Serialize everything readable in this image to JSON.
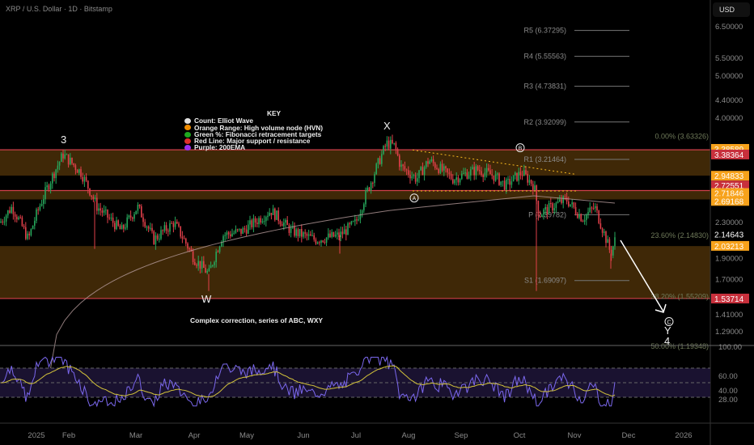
{
  "header": {
    "title": "XRP / U.S. Dollar · 1D · Bitstamp",
    "currency": "USD"
  },
  "key": {
    "title": "KEY",
    "items": [
      {
        "label": "Count: Elliot Wave",
        "color": "#e0e0e0"
      },
      {
        "label": "Orange Range: High volume node (HVN)",
        "color": "#f08c00"
      },
      {
        "label": "Green %: Fibonacci retracement targets",
        "color": "#1fa81f"
      },
      {
        "label": "Red Line: Major support / resistance",
        "color": "#e0302a"
      },
      {
        "label": "Purple: 200EMA",
        "color": "#9b30f0"
      }
    ]
  },
  "annotation": "Complex correction, series of ABC, WXY",
  "wave_labels": {
    "three": "3",
    "w": "W",
    "x": "X",
    "a": "A",
    "b": "B",
    "c": "C",
    "y": "Y",
    "four": "4"
  },
  "pivots": [
    {
      "label": "R5 (6.37295)",
      "price": 6.37295
    },
    {
      "label": "R4 (5.55563)",
      "price": 5.55563
    },
    {
      "label": "R3 (4.73831)",
      "price": 4.73831
    },
    {
      "label": "R2 (3.92099)",
      "price": 3.92099
    },
    {
      "label": "R1 (3.21464)",
      "price": 3.21464
    },
    {
      "label": "P (2.39782)",
      "price": 2.39782
    },
    {
      "label": "S1 (1.69097)",
      "price": 1.69097
    }
  ],
  "fibs": [
    {
      "label": "0.00% (3.63326)",
      "price": 3.63326
    },
    {
      "label": "23.60% (2.14830)",
      "price": 2.1483
    },
    {
      "label": "38.20% (1.55209)",
      "price": 1.55209
    },
    {
      "label": "50.00% (1.19348)",
      "price": 1.19348
    }
  ],
  "price_axis": {
    "ticks": [
      "6.50000",
      "5.50000",
      "5.00000",
      "4.40000",
      "4.00000",
      "2.30000",
      "1.90000",
      "1.70000",
      "1.41000",
      "1.29000"
    ],
    "badges": [
      {
        "text": "3.38589",
        "color": "#f7a21b",
        "price": 3.4
      },
      {
        "text": "3.38364",
        "color": "#c8303c",
        "price": 3.3
      },
      {
        "text": "2.94833",
        "color": "#f7a21b",
        "price": 2.9483
      },
      {
        "text": "2.72551",
        "color": "#c8303c",
        "price": 2.8
      },
      {
        "text": "2.71846",
        "color": "#f7a21b",
        "price": 2.69
      },
      {
        "text": "2.69168",
        "color": "#f7a21b",
        "price": 2.58
      },
      {
        "text": "2.14643",
        "color": "#000000",
        "price": 2.16
      },
      {
        "text": "2.03213",
        "color": "#f7a21b",
        "price": 2.03213
      },
      {
        "text": "1.53714",
        "color": "#c8303c",
        "price": 1.53714
      }
    ]
  },
  "rsi_axis": [
    "100.00",
    "60.00",
    "40.00",
    "28.00"
  ],
  "time_axis": [
    "2025",
    "Feb",
    "Mar",
    "Apr",
    "May",
    "Jun",
    "Jul",
    "Aug",
    "Sep",
    "Oct",
    "Nov",
    "Dec",
    "2026"
  ],
  "chart_data": {
    "type": "candlestick",
    "title": "XRP / U.S. Dollar · 1D · Bitstamp",
    "path": [
      [
        0,
        2.3
      ],
      [
        15,
        2.5
      ],
      [
        35,
        2.1
      ],
      [
        45,
        2.4
      ],
      [
        78,
        3.3
      ],
      [
        100,
        3.0
      ],
      [
        120,
        2.5
      ],
      [
        150,
        2.2
      ],
      [
        170,
        2.5
      ],
      [
        190,
        2.1
      ],
      [
        215,
        2.3
      ],
      [
        240,
        1.9
      ],
      [
        258,
        1.75
      ],
      [
        275,
        2.15
      ],
      [
        300,
        2.2
      ],
      [
        335,
        2.45
      ],
      [
        360,
        2.2
      ],
      [
        390,
        2.1
      ],
      [
        420,
        2.15
      ],
      [
        440,
        2.3
      ],
      [
        460,
        2.9
      ],
      [
        478,
        3.5
      ],
      [
        488,
        3.45
      ],
      [
        495,
        3.1
      ],
      [
        515,
        2.9
      ],
      [
        530,
        3.2
      ],
      [
        560,
        2.9
      ],
      [
        590,
        3.05
      ],
      [
        610,
        2.95
      ],
      [
        625,
        2.8
      ],
      [
        645,
        3.0
      ],
      [
        660,
        2.8
      ],
      [
        666,
        2.4
      ],
      [
        690,
        2.55
      ],
      [
        700,
        2.6
      ],
      [
        720,
        2.35
      ],
      [
        735,
        2.5
      ],
      [
        742,
        2.3
      ],
      [
        755,
        1.95
      ],
      [
        762,
        2.15
      ]
    ],
    "levels": {
      "red": [
        3.38364,
        2.72551,
        1.53714
      ],
      "hvn": [
        [
          2.95,
          3.38
        ],
        [
          2.6,
          2.72
        ],
        [
          1.537,
          2.03
        ]
      ]
    }
  }
}
